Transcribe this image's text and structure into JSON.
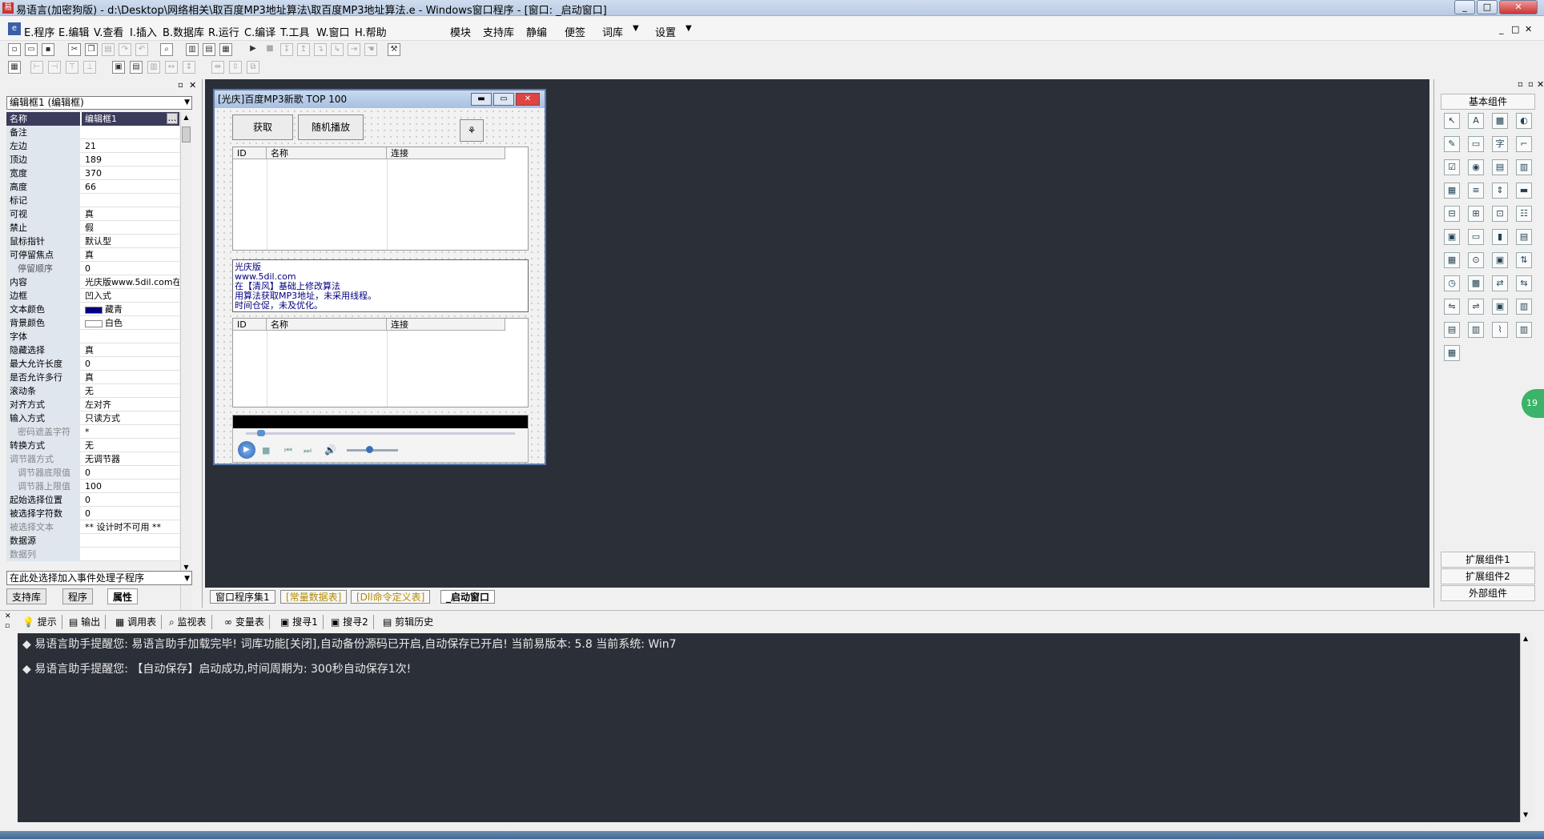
{
  "window": {
    "title": "易语言(加密狗版) - d:\\Desktop\\网络相关\\取百度MP3地址算法\\取百度MP3地址算法.e - Windows窗口程序 - [窗口: _启动窗口]",
    "app_icon": "easy-language-app-icon",
    "controls": {
      "minimize": "_",
      "maximize": "□",
      "close": "✕"
    }
  },
  "menu": {
    "items": [
      "E.程序",
      "E.编辑",
      "V.查看",
      "I.插入",
      "B.数据库",
      "R.运行",
      "C.编译",
      "T.工具",
      "W.窗口",
      "H.帮助"
    ],
    "extra": [
      "模块",
      "支持库",
      "静编",
      "便签",
      "词库",
      "设置"
    ],
    "mdi_controls": [
      "_",
      "□",
      "✕"
    ]
  },
  "property_panel": {
    "selector": "编辑框1 (编辑框)",
    "rows": [
      {
        "k": "名称",
        "v": "编辑框1",
        "sel": true
      },
      {
        "k": "备注",
        "v": ""
      },
      {
        "k": "左边",
        "v": "21"
      },
      {
        "k": "顶边",
        "v": "189"
      },
      {
        "k": "宽度",
        "v": "370"
      },
      {
        "k": "高度",
        "v": "66"
      },
      {
        "k": "标记",
        "v": ""
      },
      {
        "k": "可视",
        "v": "真"
      },
      {
        "k": "禁止",
        "v": "假"
      },
      {
        "k": "鼠标指针",
        "v": "默认型"
      },
      {
        "k": "可停留焦点",
        "v": "真"
      },
      {
        "k": "停留顺序",
        "v": "0",
        "sub": true
      },
      {
        "k": "内容",
        "v": "光庆版www.5dil.com在"
      },
      {
        "k": "边框",
        "v": "凹入式"
      },
      {
        "k": "文本颜色",
        "v": "藏青",
        "swatch": "#000080"
      },
      {
        "k": "背景颜色",
        "v": "白色",
        "swatch": "#ffffff"
      },
      {
        "k": "字体",
        "v": ""
      },
      {
        "k": "隐藏选择",
        "v": "真"
      },
      {
        "k": "最大允许长度",
        "v": "0"
      },
      {
        "k": "是否允许多行",
        "v": "真"
      },
      {
        "k": "滚动条",
        "v": "无"
      },
      {
        "k": "对齐方式",
        "v": "左对齐"
      },
      {
        "k": "输入方式",
        "v": "只读方式"
      },
      {
        "k": "密码遮盖字符",
        "v": "*",
        "sub": true,
        "gray": true
      },
      {
        "k": "转换方式",
        "v": "无"
      },
      {
        "k": "调节器方式",
        "v": "无调节器",
        "gray": true
      },
      {
        "k": "调节器底限值",
        "v": "0",
        "sub": true,
        "gray": true
      },
      {
        "k": "调节器上限值",
        "v": "100",
        "sub": true,
        "gray": true
      },
      {
        "k": "起始选择位置",
        "v": "0"
      },
      {
        "k": "被选择字符数",
        "v": "0"
      },
      {
        "k": "被选择文本",
        "v": "** 设计时不可用 **",
        "gray": true
      },
      {
        "k": "数据源",
        "v": ""
      },
      {
        "k": "数据列",
        "v": "",
        "gray": true
      }
    ],
    "event_selector": "在此处选择加入事件处理子程序",
    "tabs": [
      "支持库",
      "程序",
      "属性"
    ]
  },
  "form": {
    "title": "[光庆]百度MP3新歌 TOP 100",
    "btn_fetch": "获取",
    "btn_random": "随机播放",
    "list_headers": [
      "ID",
      "名称",
      "连接"
    ],
    "edit_lines": [
      "光庆版",
      "www.5dil.com",
      "在【清风】基础上修改算法",
      "用算法获取MP3地址，未采用线程。",
      "时间仓促，未及优化。"
    ]
  },
  "right_panel": {
    "basic": "基本组件",
    "ext1": "扩展组件1",
    "ext2": "扩展组件2",
    "external": "外部组件",
    "badge": "19"
  },
  "file_tabs": [
    "窗口程序集1",
    "[常量数据表]",
    "[Dll命令定义表]",
    "_启动窗口"
  ],
  "output_tabs": [
    "提示",
    "输出",
    "调用表",
    "监视表",
    "变量表",
    "搜寻1",
    "搜寻2",
    "剪辑历史"
  ],
  "output_lines": [
    "◆ 易语言助手提醒您:  易语言助手加载完毕!  词库功能[关闭],自动备份源码已开启,自动保存已开启!  当前易版本: 5.8  当前系统: Win7",
    "◆ 易语言助手提醒您: 【自动保存】启动成功,时间周期为: 300秒自动保存1次!"
  ]
}
